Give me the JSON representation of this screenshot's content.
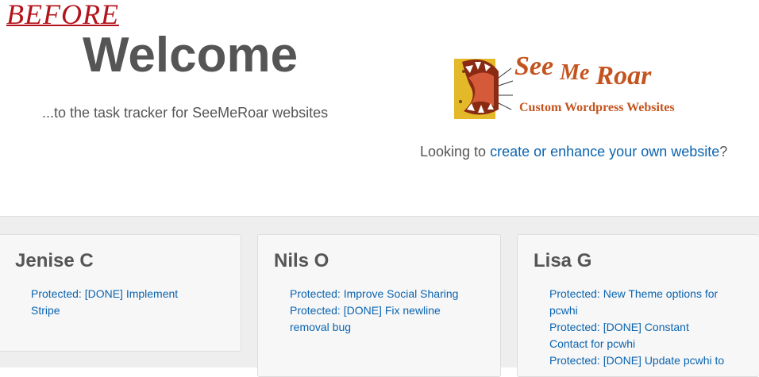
{
  "overlay": {
    "label": "BEFORE"
  },
  "hero": {
    "title": "Welcome",
    "subtitle": "...to the task tracker for SeeMeRoar websites"
  },
  "logo": {
    "word1": "See",
    "word2": "Me",
    "word3": "Roar",
    "tagline": "Custom Wordpress Websites",
    "colors": {
      "text": "#c4541f",
      "face": "#e3b829",
      "mouth": "#8a2a12"
    }
  },
  "cta": {
    "prefix": "Looking to ",
    "link": "create or enhance your own website",
    "suffix": "?"
  },
  "cards": [
    {
      "name": "Jenise C",
      "tasks": [
        "Protected: [DONE] Implement",
        "Stripe"
      ]
    },
    {
      "name": "Nils O",
      "tasks": [
        "Protected: Improve Social Sharing",
        "Protected: [DONE] Fix newline",
        "removal bug"
      ]
    },
    {
      "name": "Lisa G",
      "tasks": [
        "Protected: New Theme options for",
        "pcwhi",
        "Protected: [DONE] Constant",
        "Contact for pcwhi",
        "Protected: [DONE] Update pcwhi to"
      ]
    }
  ],
  "colors": {
    "link": "#0b64b0",
    "heading": "#555555",
    "before": "#b3141b",
    "band": "#eeeeee",
    "card": "#f7f7f7"
  }
}
